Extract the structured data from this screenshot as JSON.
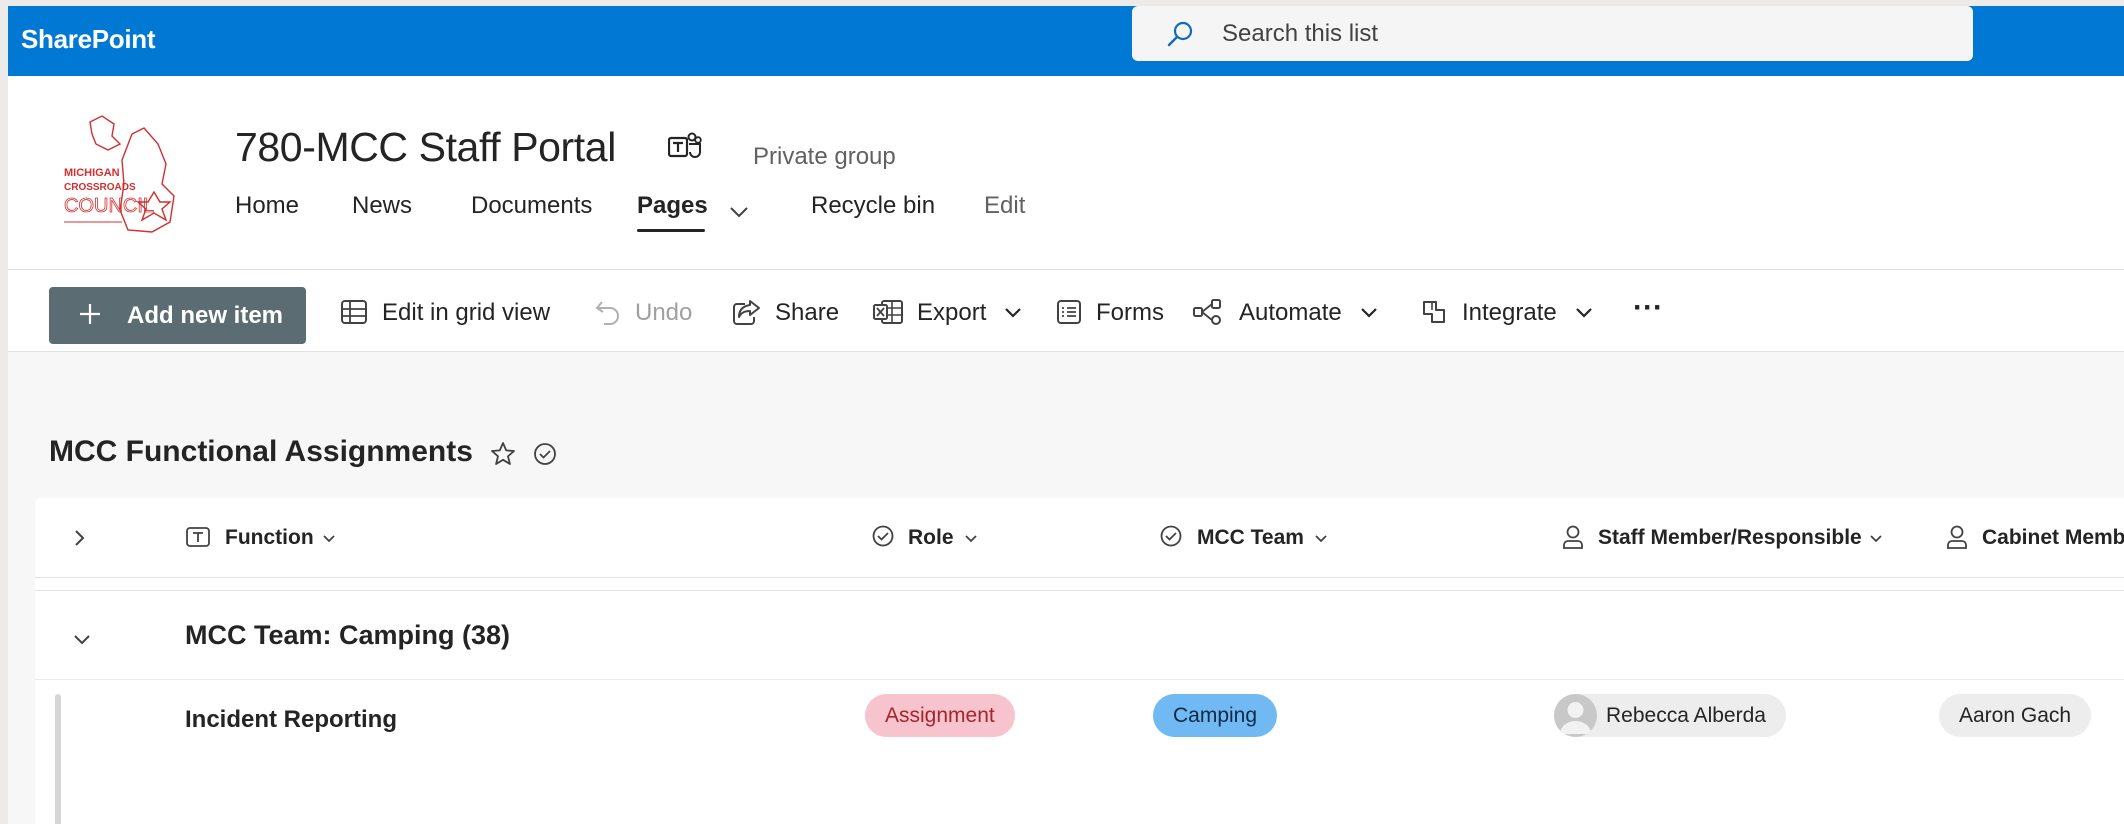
{
  "app": {
    "brand": "SharePoint"
  },
  "search": {
    "placeholder": "Search this list"
  },
  "site": {
    "title": "780-MCC Staff Portal",
    "privacy": "Private group",
    "logo_text": [
      "MICHIGAN",
      "CROSSROADS",
      "COUNCIL"
    ]
  },
  "nav": {
    "items": [
      {
        "label": "Home"
      },
      {
        "label": "News"
      },
      {
        "label": "Documents"
      },
      {
        "label": "Pages"
      },
      {
        "label": "Recycle bin"
      },
      {
        "label": "Edit"
      }
    ],
    "active": "Pages"
  },
  "commands": {
    "add_new_item": "Add new item",
    "edit_grid": "Edit in grid view",
    "undo": "Undo",
    "share": "Share",
    "export": "Export",
    "forms": "Forms",
    "automate": "Automate",
    "integrate": "Integrate",
    "more": "···"
  },
  "list": {
    "title": "MCC Functional Assignments",
    "columns": [
      {
        "label": "Function",
        "icon": "text-field-icon"
      },
      {
        "label": "Role",
        "icon": "choice-check-icon"
      },
      {
        "label": "MCC Team",
        "icon": "choice-check-icon"
      },
      {
        "label": "Staff Member/Responsible",
        "icon": "person-icon"
      },
      {
        "label": "Cabinet Memb",
        "icon": "person-icon"
      }
    ],
    "group": {
      "title": "MCC Team: Camping (38)"
    },
    "rows": [
      {
        "function": "Incident Reporting",
        "role": "Assignment",
        "team": "Camping",
        "staff": "Rebecca Alberda",
        "cabinet": "Aaron Gach"
      }
    ]
  },
  "colors": {
    "suitebar": "#0078d4",
    "add_button": "#5b6c73",
    "role_pill": "#f7c3cc",
    "team_pill": "#71b9f2",
    "logo_red": "#d32f2f"
  }
}
